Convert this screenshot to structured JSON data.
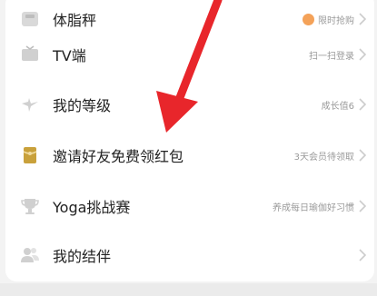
{
  "menu": {
    "items": [
      {
        "label": "体脂秤",
        "hint": "限时抢购",
        "icon": "scale-icon",
        "has_badge": true
      },
      {
        "label": "TV端",
        "hint": "扫一扫登录",
        "icon": "tv-icon"
      },
      {
        "label": "我的等级",
        "hint": "成长值6",
        "icon": "level-icon"
      },
      {
        "label": "邀请好友免费领红包",
        "hint": "3天会员待领取",
        "icon": "red-packet-icon"
      },
      {
        "label": "Yoga挑战赛",
        "hint": "养成每日瑜伽好习惯",
        "icon": "trophy-icon"
      },
      {
        "label": "我的结伴",
        "hint": "",
        "icon": "partners-icon"
      }
    ]
  },
  "annotation": {
    "icon": "red-arrow-icon",
    "color": "#e8262b"
  },
  "colors": {
    "card": "#ffffff",
    "background": "#f3f3f3",
    "text": "#222222",
    "hint": "#9a9a9a",
    "accent_gold": "#c9a13b"
  }
}
